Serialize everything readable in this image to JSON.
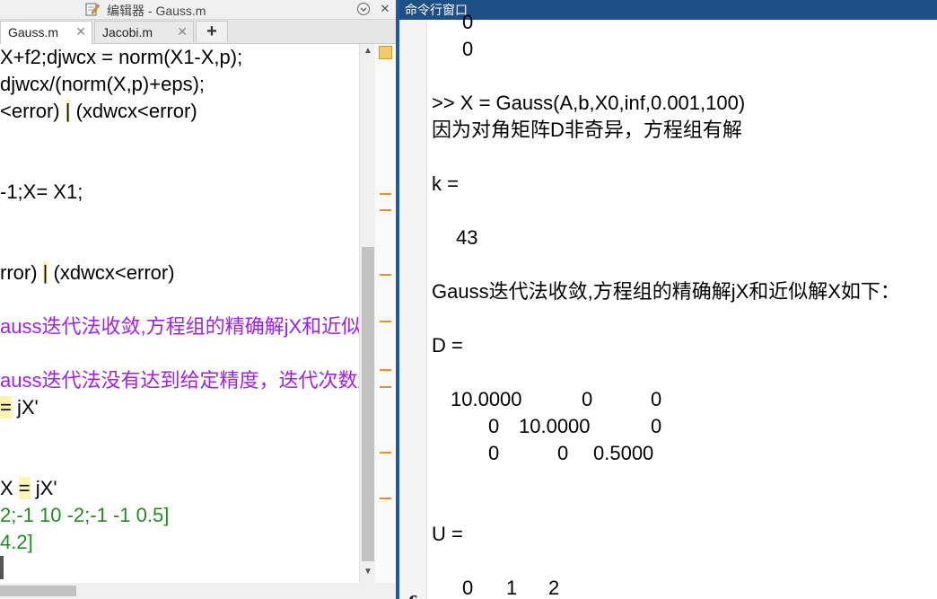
{
  "editor": {
    "window_title": "编辑器 - Gauss.m",
    "tabs": [
      {
        "label": "Gauss.m",
        "close": "✕"
      },
      {
        "label": "Jacobi.m",
        "close": "✕"
      }
    ],
    "add_tab": "+",
    "lines": {
      "l1": "X+f2;djwcx = norm(X1-X,p);",
      "l2": "djwcx/(norm(X,p)+eps);",
      "l3a": "<error) ",
      "l3b": "|",
      "l3c": " (xdwcx<error)",
      "l4": "-1;X= X1;",
      "l5a": "rror) ",
      "l5b": "|",
      "l5c": " (xdwcx<error)",
      "l6": "auss迭代法收敛,方程组的精确解jX和近似",
      "l7": "auss迭代法没有达到给定精度，迭代次数超",
      "l8a": "=",
      "l8b": " jX'",
      "l9a": "X ",
      "l9b": "=",
      "l9c": " jX'",
      "l10": "2;-1 10 -2;-1 -1 0.5]",
      "l11": "4.2]"
    }
  },
  "command_window": {
    "title": "命令行窗口",
    "fx": "fx",
    "lines": {
      "c1": "0",
      "c2": "0",
      "c3": ">> X = Gauss(A,b,X0,inf,0.001,100)",
      "c4": "因为对角矩阵D非奇异，方程组有解",
      "c5": "k =",
      "c6": "43",
      "c7": "Gauss迭代法收敛,方程组的精确解jX和近似解X如下：",
      "c8": "D =",
      "d1a": "10.0000",
      "d1b": "0",
      "d1c": "0",
      "d2a": "0",
      "d2b": "10.0000",
      "d2c": "0",
      "d3a": "0",
      "d3b": "0",
      "d3c": "0.5000",
      "c9": "U =",
      "u1a": "0",
      "u1b": "1",
      "u1c": "2"
    }
  }
}
